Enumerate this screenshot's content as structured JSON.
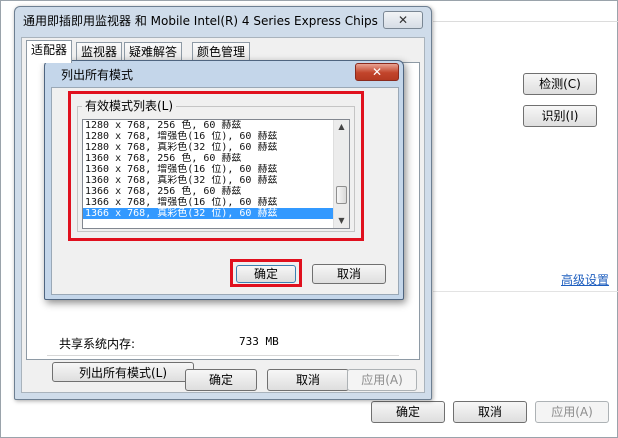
{
  "background_window": {
    "detect_label": "检测(C)",
    "identify_label": "识别(I)",
    "advanced_link": "高级设置",
    "ok_label": "确定",
    "cancel_label": "取消",
    "apply_label": "应用(A)"
  },
  "properties_dialog": {
    "title": "通用即插即用监视器 和 Mobile Intel(R) 4 Series Express Chips",
    "close_symbol": "✕",
    "tabs": [
      {
        "label": "适配器",
        "active": true
      },
      {
        "label": "监视器",
        "active": false
      },
      {
        "label": "疑难解答",
        "active": false
      },
      {
        "label": "颜色管理",
        "active": false
      }
    ],
    "shared_memory_label": "共享系统内存:",
    "shared_memory_value": "733 MB",
    "list_all_modes_label": "列出所有模式(L)",
    "ok_label": "确定",
    "cancel_label": "取消",
    "apply_label": "应用(A)"
  },
  "modal": {
    "title": "列出所有模式",
    "close_symbol": "✕",
    "group_label": "有效模式列表(L)",
    "modes": [
      "1280 x 768, 256 色, 60 赫兹",
      "1280 x 768, 增强色(16 位), 60 赫兹",
      "1280 x 768, 真彩色(32 位), 60 赫兹",
      "1360 x 768, 256 色, 60 赫兹",
      "1360 x 768, 增强色(16 位), 60 赫兹",
      "1360 x 768, 真彩色(32 位), 60 赫兹",
      "1366 x 768, 256 色, 60 赫兹",
      "1366 x 768, 增强色(16 位), 60 赫兹",
      "1366 x 768, 真彩色(32 位), 60 赫兹"
    ],
    "selected_index": 8,
    "ok_label": "确定",
    "cancel_label": "取消",
    "scroll_up_symbol": "▲",
    "scroll_down_symbol": "▼"
  },
  "colors": {
    "highlight_border": "#e0101e",
    "selection": "#3399ff",
    "link": "#1f5fbf"
  }
}
